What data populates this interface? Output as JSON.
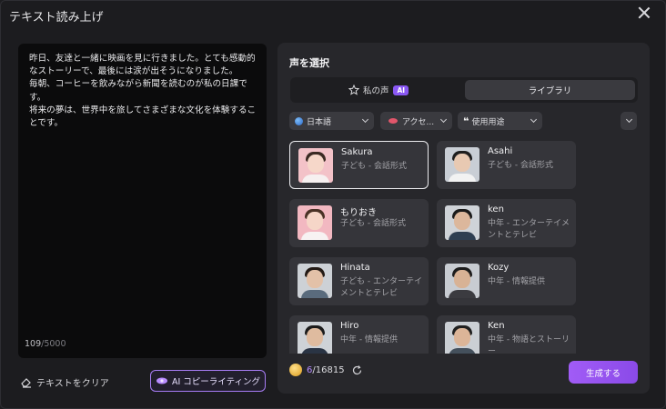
{
  "window": {
    "title": "テキスト読み上げ"
  },
  "editor": {
    "text": "昨日、友達と一緒に映画を見に行きました。とても感動的なストーリーで、最後には涙が出そうになりました。\n毎朝、コーヒーを飲みながら新聞を読むのが私の日課です。\n将来の夢は、世界中を旅してさまざまな文化を体験することです。",
    "count": "109",
    "limit": "/5000"
  },
  "actions": {
    "clear_label": "テキストをクリア",
    "ai_label": "AI コピーライティング"
  },
  "panel": {
    "title": "声を選択",
    "tabs": [
      {
        "label": "私の声",
        "badge": "AI"
      },
      {
        "label": "ライブラリ"
      }
    ],
    "filters": {
      "language": "日本語",
      "accent": "アクセ...",
      "usage": "使用用途"
    },
    "voices": [
      {
        "name": "Sakura",
        "desc": "子ども - 会話形式",
        "selected": true
      },
      {
        "name": "Asahi",
        "desc": "子ども - 会話形式"
      },
      {
        "name": "もりおき",
        "desc": "子ども - 会話形式"
      },
      {
        "name": "ken",
        "desc": "中年 - エンターテイメントとテレビ"
      },
      {
        "name": "Hinata",
        "desc": "子ども - エンターテイメントとテレビ"
      },
      {
        "name": "Kozy",
        "desc": "中年 - 情報提供"
      },
      {
        "name": "Hiro",
        "desc": "中年 - 情報提供"
      },
      {
        "name": "Ken",
        "desc": "中年 - 物語とストーリー"
      }
    ],
    "credits": {
      "used": "6",
      "total": "/16815"
    },
    "generate_label": "生成する"
  },
  "colors": {
    "accent": "#8a58f3",
    "panel": "#27272b",
    "card": "#35353a"
  }
}
